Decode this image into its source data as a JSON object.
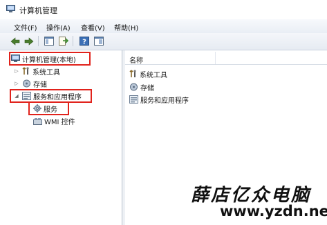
{
  "window": {
    "title": "计算机管理",
    "app_icon": "computer-management-icon"
  },
  "menu": [
    {
      "label": "文件(F)"
    },
    {
      "label": "操作(A)"
    },
    {
      "label": "查看(V)"
    },
    {
      "label": "帮助(H)"
    }
  ],
  "toolbar": {
    "buttons": [
      "back-arrow-icon",
      "forward-arrow-icon",
      "show-hide-tree-icon",
      "export-list-icon",
      "help-icon",
      "properties-icon"
    ]
  },
  "tree": {
    "root": {
      "label": "计算机管理(本地)",
      "icon": "computer-management-icon"
    },
    "items": [
      {
        "label": "系统工具",
        "icon": "tools-icon",
        "expander": "▷"
      },
      {
        "label": "存储",
        "icon": "storage-icon",
        "expander": "▷"
      },
      {
        "label": "服务和应用程序",
        "icon": "services-apps-icon",
        "expander": "◢"
      }
    ],
    "children": [
      {
        "label": "服务",
        "icon": "services-gear-icon"
      },
      {
        "label": "WMI 控件",
        "icon": "wmi-control-icon"
      }
    ]
  },
  "list": {
    "column_header": "名称",
    "rows": [
      {
        "label": "系统工具",
        "icon": "tools-icon"
      },
      {
        "label": "存储",
        "icon": "storage-icon"
      },
      {
        "label": "服务和应用程序",
        "icon": "services-apps-icon"
      }
    ]
  },
  "watermark": {
    "text": "薛店亿众电脑",
    "url": "www.yzdn.net"
  },
  "colors": {
    "highlight_box": "#e1221b",
    "menubar": "#eef2f7",
    "pane_border": "#b9c3cf"
  }
}
